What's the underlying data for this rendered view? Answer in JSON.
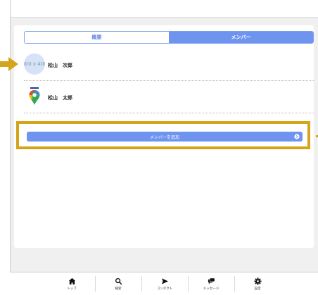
{
  "segments": [
    {
      "label": "概要",
      "active": false
    },
    {
      "label": "メンバー",
      "active": true
    }
  ],
  "members": [
    {
      "name": "松山　次郎",
      "avatar_text": "600 x 400"
    },
    {
      "name": "松山　太郎",
      "avatar_icon": "map-pin-icon"
    }
  ],
  "add_member": {
    "label": "メンバーを追加",
    "icon": "chevron-right-circle-icon"
  },
  "tabbar": [
    {
      "label": "トップ",
      "icon": "home-icon"
    },
    {
      "label": "検索",
      "icon": "search-icon"
    },
    {
      "label": "コンタクト",
      "icon": "send-icon"
    },
    {
      "label": "メッセージ",
      "icon": "chat-icon"
    },
    {
      "label": "設定",
      "icon": "gear-icon"
    }
  ],
  "colors": {
    "accent": "#6f94f0",
    "highlight": "#d4a51a"
  }
}
